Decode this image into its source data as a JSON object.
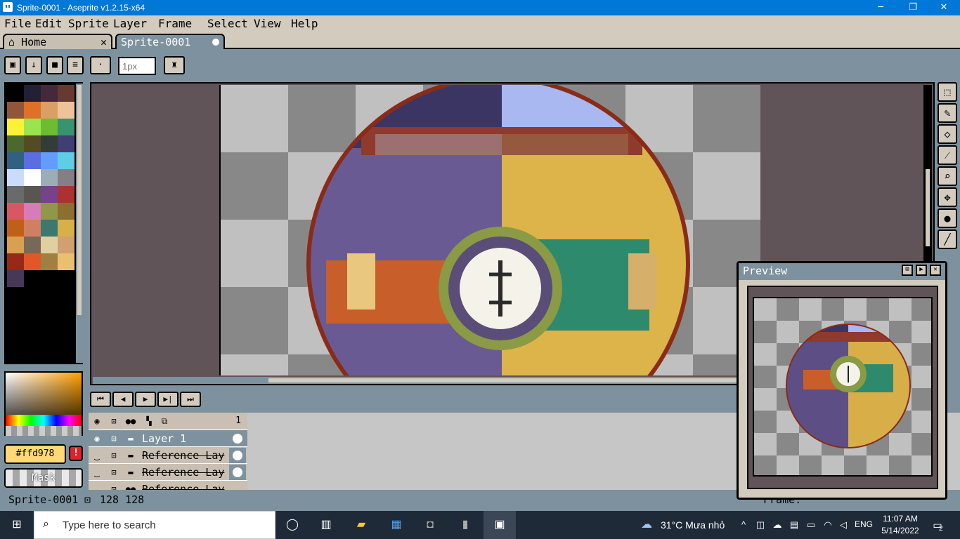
{
  "window": {
    "title": "Sprite-0001 - Aseprite v1.2.15-x64",
    "minimize": "─",
    "restore": "❐",
    "close": "✕"
  },
  "menu": [
    "File",
    "Edit",
    "Sprite",
    "Layer",
    "Frame",
    "Select",
    "View",
    "Help"
  ],
  "tabs": {
    "home": "Home",
    "home_close": "✕",
    "sprite": "Sprite-0001"
  },
  "toolbar": {
    "brush_size_placeholder": "1px",
    "dot": "·"
  },
  "palette": [
    "#000000",
    "#222034",
    "#45283c",
    "#663931",
    "#8f563b",
    "#df7126",
    "#d9a066",
    "#eec39a",
    "#fbf236",
    "#99e550",
    "#6abe30",
    "#37946e",
    "#4b692f",
    "#524b24",
    "#323c39",
    "#3f3f74",
    "#306082",
    "#5b6ee1",
    "#639bff",
    "#5fcde4",
    "#cbdbfc",
    "#ffffff",
    "#9badb7",
    "#847e87",
    "#696a6a",
    "#595652",
    "#76428a",
    "#ac3232",
    "#d95763",
    "#d77bba",
    "#8f974a",
    "#8a6f30",
    "#c06018",
    "#d08060",
    "#3a7870",
    "#d8b048",
    "#d8a050",
    "#786858",
    "#e0d0a0",
    "#d0a070",
    "#982818",
    "#e05828",
    "#a08040",
    "#e8c070",
    "#483858"
  ],
  "color": {
    "fg_hex": "#ffd978",
    "fg_label": "#ffd978",
    "warn": "!",
    "mask": "Mask"
  },
  "timeline": {
    "controls": [
      "⏮",
      "◀",
      "▶",
      "▶|",
      "⏭"
    ],
    "frame_number": "1",
    "layers": [
      {
        "name": "Layer 1",
        "selected": true,
        "hidden": false
      },
      {
        "name": "Reference Lay",
        "selected": false,
        "hidden": true
      },
      {
        "name": "Reference Lay",
        "selected": false,
        "hidden": true
      },
      {
        "name": "Reference Lay",
        "selected": false,
        "hidden": true
      }
    ]
  },
  "status": {
    "sprite": "Sprite-0001",
    "size": "128 128",
    "frame_label": "Frame:"
  },
  "preview": {
    "title": "Preview"
  },
  "taskbar": {
    "search_placeholder": "Type here to search",
    "weather": "31°C  Mưa nhỏ",
    "lang": "ENG",
    "time": "11:07 AM",
    "date": "5/14/2022",
    "notifications": "2"
  }
}
